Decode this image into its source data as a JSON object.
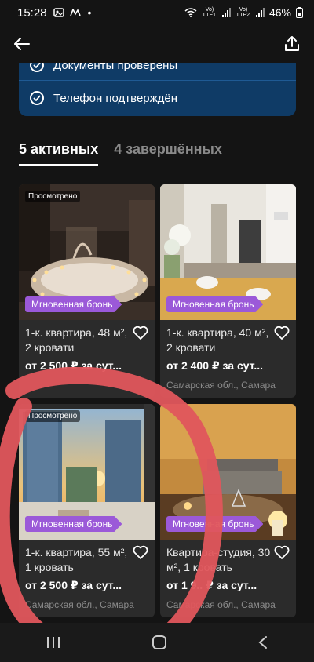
{
  "status_bar": {
    "time": "15:28",
    "battery": "46%",
    "sim1": "Vo) LTE1",
    "sim2": "Vo) LTE2"
  },
  "verification": {
    "row1": "Документы проверены",
    "row2": "Телефон подтверждён"
  },
  "tabs": [
    {
      "label": "5 активных",
      "active": true
    },
    {
      "label": "4 завершённых",
      "active": false
    }
  ],
  "listings": [
    {
      "viewed": "Просмотрено",
      "badge": "Мгновенная бронь",
      "title": "1-к. квартира, 48 м², 2 кровати",
      "price": "от 2 500 ₽ за сут...",
      "location": "",
      "image": "jacuzzi-room"
    },
    {
      "viewed": "",
      "badge": "Мгновенная бронь",
      "title": "1-к. квартира, 40 м², 2 кровати",
      "price": "от 2 400 ₽ за сут...",
      "location": "Самарская обл., Самара",
      "image": "bright-studio"
    },
    {
      "viewed": "Просмотрено",
      "badge": "Мгновенная бронь",
      "title": "1-к. квартира, 55 м², 1 кровать",
      "price": "от 2 500 ₽ за сут...",
      "location": "Самарская обл., Самара",
      "image": "city-view-window"
    },
    {
      "viewed": "",
      "badge": "Мгновенная бронь",
      "title": "Квартира-студия, 30 м², 1 кровать",
      "price": "от 1 9.. ₽ за сут...",
      "location": "Самарская обл., Самара",
      "image": "candle-room"
    }
  ],
  "colors": {
    "background": "#141414",
    "card": "#2b2b2b",
    "verify_bg": "#0f3b66",
    "badge": "#9b59d8",
    "annotation": "#e0565c"
  }
}
